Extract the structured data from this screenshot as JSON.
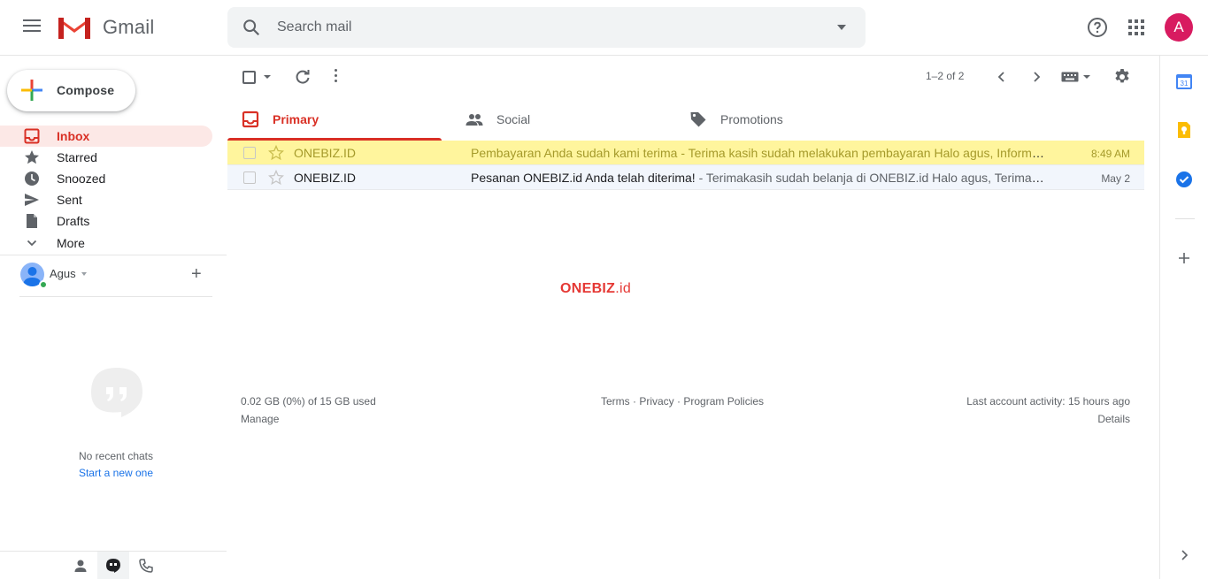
{
  "app": {
    "name": "Gmail",
    "account_initial": "A"
  },
  "search": {
    "placeholder": "Search mail"
  },
  "compose": {
    "label": "Compose"
  },
  "nav": {
    "items": [
      {
        "label": "Inbox",
        "icon": "inbox-icon",
        "active": true
      },
      {
        "label": "Starred",
        "icon": "star-icon"
      },
      {
        "label": "Snoozed",
        "icon": "clock-icon"
      },
      {
        "label": "Sent",
        "icon": "send-icon"
      },
      {
        "label": "Drafts",
        "icon": "draft-icon"
      },
      {
        "label": "More",
        "icon": "chevron-down-icon"
      }
    ]
  },
  "hangouts": {
    "user_name": "Agus",
    "no_chats": "No recent chats",
    "start_new": "Start a new one"
  },
  "toolbar": {
    "pager": "1–2 of 2"
  },
  "tabs": [
    {
      "label": "Primary",
      "icon": "inbox-icon",
      "active": true
    },
    {
      "label": "Social",
      "icon": "people-icon"
    },
    {
      "label": "Promotions",
      "icon": "tag-icon"
    }
  ],
  "emails": [
    {
      "sender": "ONEBIZ.ID",
      "subject": "Pembayaran Anda sudah kami terima",
      "snippet": " - Terima kasih sudah melakukan pembayaran Halo agus, Informasi pembayaran",
      "date": "8:49 AM",
      "highlighted": true
    },
    {
      "sender": "ONEBIZ.ID",
      "subject": "Pesanan ONEBIZ.id Anda telah diterima!",
      "snippet": " - Terimakasih sudah belanja di ONEBIZ.id Halo agus, Terima kasih",
      "date": "May 2",
      "highlighted": false
    }
  ],
  "watermark": {
    "brand": "ONEBIZ",
    "suffix": ".id"
  },
  "footer": {
    "storage": "0.02 GB (0%) of 15 GB used",
    "manage": "Manage",
    "terms": "Terms",
    "privacy": "Privacy",
    "policies": "Program Policies",
    "separator": " · ",
    "activity": "Last account activity: 15 hours ago",
    "details": "Details"
  },
  "colors": {
    "brand_red": "#d93025",
    "highlight": "#fff59d",
    "link_blue": "#1a73e8"
  }
}
